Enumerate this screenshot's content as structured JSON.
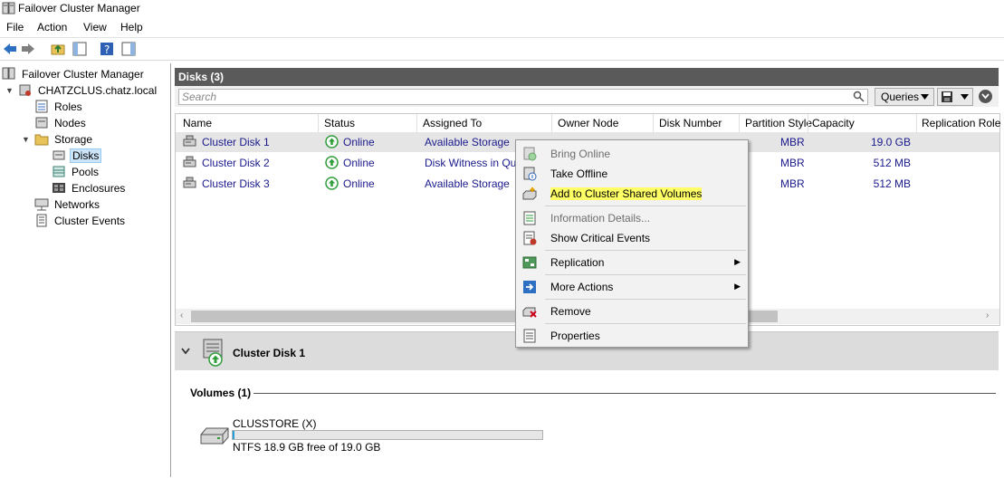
{
  "window": {
    "title": "Failover Cluster Manager"
  },
  "menu": [
    "File",
    "Action",
    "View",
    "Help"
  ],
  "tree": {
    "root": "Failover Cluster Manager",
    "cluster": "CHATZCLUS.chatz.local",
    "roles": "Roles",
    "nodes": "Nodes",
    "storage": "Storage",
    "disks": "Disks",
    "pools": "Pools",
    "enclosures": "Enclosures",
    "networks": "Networks",
    "events": "Cluster Events"
  },
  "disks_pane": {
    "title": "Disks (3)",
    "search_placeholder": "Search",
    "queries_label": "Queries",
    "columns": [
      "Name",
      "Status",
      "Assigned To",
      "Owner Node",
      "Disk Number",
      "Partition Style",
      "Capacity",
      "Replication Role"
    ],
    "rows": [
      {
        "name": "Cluster Disk 1",
        "status": "Online",
        "assigned": "Available Storage",
        "partition": "MBR",
        "capacity": "19.0 GB"
      },
      {
        "name": "Cluster Disk 2",
        "status": "Online",
        "assigned": "Disk Witness in Quorum",
        "partition": "MBR",
        "capacity": "512 MB"
      },
      {
        "name": "Cluster Disk 3",
        "status": "Online",
        "assigned": "Available Storage",
        "partition": "MBR",
        "capacity": "512 MB"
      }
    ]
  },
  "context_menu": {
    "items": [
      {
        "label": "Bring Online",
        "disabled": true
      },
      {
        "label": "Take Offline",
        "disabled": false
      },
      {
        "label": "Add to Cluster Shared Volumes",
        "disabled": false,
        "highlighted": true
      },
      {
        "label": "Information Details...",
        "disabled": true
      },
      {
        "label": "Show Critical Events",
        "disabled": false
      },
      {
        "label": "Replication",
        "disabled": false,
        "submenu": true
      },
      {
        "label": "More Actions",
        "disabled": false,
        "submenu": true
      },
      {
        "label": "Remove",
        "disabled": false
      },
      {
        "label": "Properties",
        "disabled": false
      }
    ]
  },
  "details": {
    "title": "Cluster Disk 1",
    "volumes_header": "Volumes (1)",
    "volume_name": "CLUSSTORE (X)",
    "volume_free": "NTFS 18.9 GB free of 19.0 GB",
    "volume_used_fraction": 0.005
  },
  "colors": {
    "highlight": "#ffff66",
    "selection": "#cce4f7",
    "online_green": "#2e9d3a",
    "link_blue": "#1a1a8c"
  }
}
